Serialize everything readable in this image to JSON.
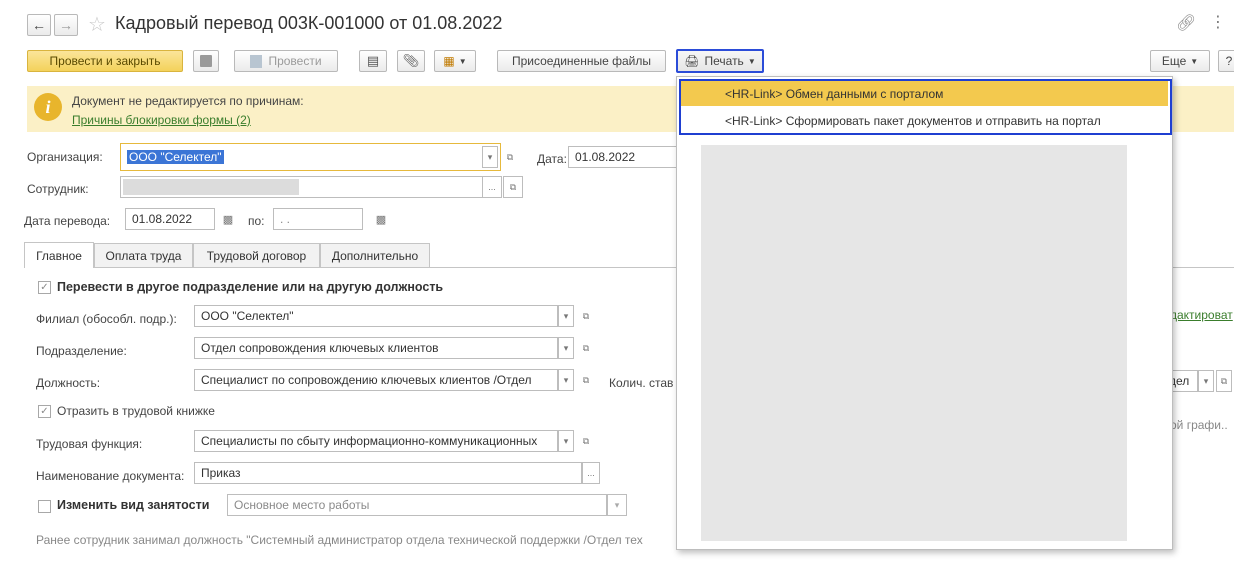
{
  "window": {
    "title": "Кадровый перевод 003К-001000 от 01.08.2022",
    "back_icon": "arrow-left-icon",
    "forward_icon": "arrow-right-icon",
    "star_icon": "star-icon",
    "link_icon": "link-icon",
    "more_icon": "vertical-dots-icon"
  },
  "toolbar": {
    "post_close": "Провести и закрыть",
    "post": "Провести",
    "attached_files": "Присоединенные файлы",
    "print": "Печать",
    "more": "Еще",
    "help": "?"
  },
  "info": {
    "message": "Документ не редактируется по причинам:",
    "link": "Причины блокировки формы (2)"
  },
  "form": {
    "org_label": "Организация:",
    "org_value": "ООО \"Селектел\"",
    "date_label": "Дата:",
    "date_value": "01.08.2022",
    "employee_label": "Сотрудник:",
    "transfer_date_label": "Дата перевода:",
    "transfer_date_value": "01.08.2022",
    "to_label": "по:",
    "to_value": " .  ."
  },
  "tabs": [
    "Главное",
    "Оплата труда",
    "Трудовой договор",
    "Дополнительно"
  ],
  "main": {
    "transfer_checkbox": "Перевести в другое подразделение или на другую должность",
    "branch_label": "Филиал (обособл. подр.):",
    "branch_value": "ООО \"Селектел\"",
    "dept_label": "Подразделение:",
    "dept_value": "Отдел сопровождения ключевых клиентов",
    "position_label": "Должность:",
    "position_value": "Специалист по сопровождению ключевых клиентов /Отдел",
    "rate_label": "Колич. став",
    "workbook_checkbox": "Отразить в трудовой книжке",
    "function_label": "Трудовая функция:",
    "function_value": "Специалисты по сбыту информационно-коммуникационных",
    "doc_name_label": "Наименование документа:",
    "doc_name_value": "Приказ",
    "employment_checkbox": "Изменить вид занятости",
    "employment_value": "Основное место работы",
    "previous_note": "Ранее сотрудник занимал должность \"Системный администратор отдела технической поддержки /Отдел тех",
    "right_edit_link": "дактироват",
    "right_dept_value": "дел",
    "right_schedule": "ой графи.."
  },
  "print_menu": {
    "items": [
      "<HR-Link> Обмен данными с порталом",
      "<HR-Link> Сформировать пакет документов и отправить на портал"
    ]
  },
  "colors": {
    "accent_yellow": "#f3d25b",
    "info_bg": "#fbf0c6",
    "highlight_border": "#1f3fd1",
    "link_green": "#3a7d2c"
  }
}
